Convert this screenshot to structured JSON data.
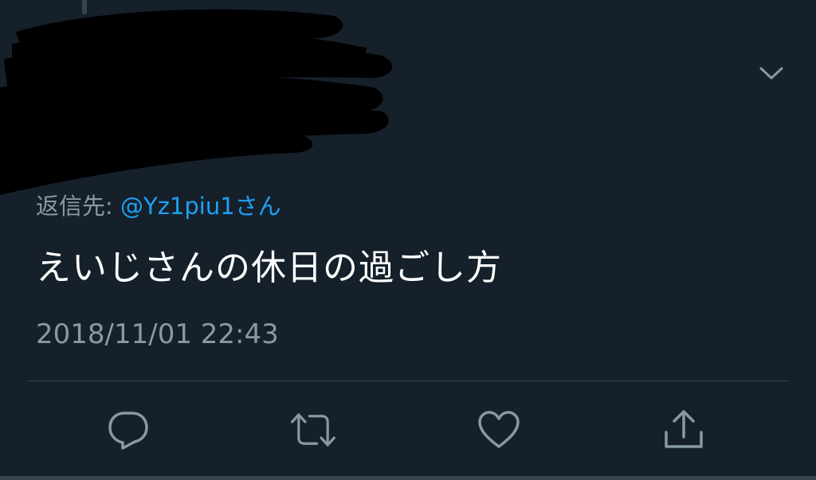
{
  "tweet": {
    "reply_prefix": "返信先: ",
    "reply_handle": "@Yz1piu1さん",
    "text": "えいじさんの休日の過ごし方",
    "timestamp": "2018/11/01 22:43"
  },
  "icons": {
    "more": "chevron-down-icon",
    "reply": "reply-icon",
    "retweet": "retweet-icon",
    "like": "heart-icon",
    "share": "share-icon"
  },
  "colors": {
    "background": "#15202b",
    "muted": "#8899a6",
    "link": "#1da1f2",
    "text": "#ffffff",
    "divider": "#38444d"
  }
}
